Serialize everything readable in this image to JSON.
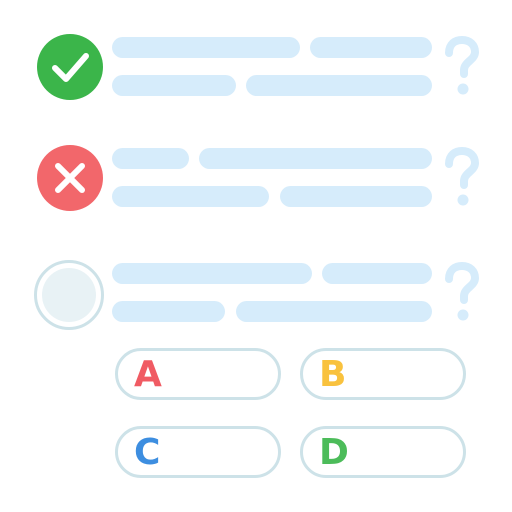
{
  "questions": [
    {
      "status": "correct",
      "status_icon": "check-icon",
      "status_color": "#3bb54a"
    },
    {
      "status": "incorrect",
      "status_icon": "close-icon",
      "status_color": "#f2676b"
    },
    {
      "status": "unanswered",
      "status_icon": "empty-circle-icon",
      "status_color": "#e8f2f5"
    }
  ],
  "options": [
    {
      "letter": "A",
      "color": "#f05b63"
    },
    {
      "letter": "B",
      "color": "#f9c23e"
    },
    {
      "letter": "C",
      "color": "#3d8ee0"
    },
    {
      "letter": "D",
      "color": "#4cbc5a"
    }
  ],
  "colors": {
    "placeholder_line": "#d6ecfb",
    "question_mark": "#d6ecfb",
    "option_border": "#cde2e8"
  }
}
